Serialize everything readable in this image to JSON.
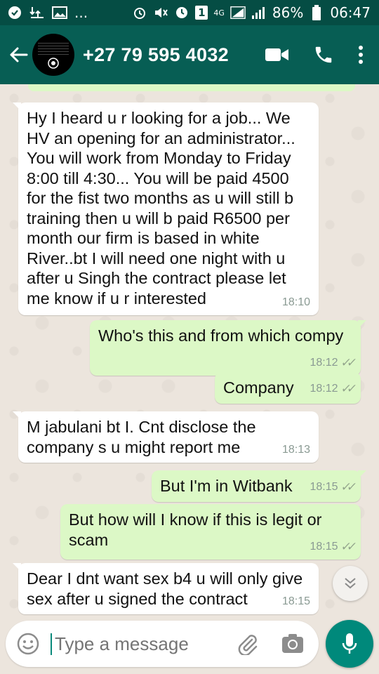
{
  "status_bar": {
    "left_ellipsis": "...",
    "network": "4G",
    "sim_badge": "1",
    "battery": "86%",
    "time": "06:47"
  },
  "header": {
    "contact": "+27 79 595 4032"
  },
  "messages": [
    {
      "dir": "in",
      "text": "Hy I heard u r looking for a job... We HV an opening for an administrator... You will work from Monday to Friday 8:00 till 4:30... You will be paid 4500 for the fist two months as u will still b training then u will b paid R6500 per month our firm is based in white River..bt I will need one night with u after u Singh the contract please let me know if u r interested",
      "time": "18:10"
    },
    {
      "dir": "out",
      "text": "Who's this and from which compy",
      "time": "18:12"
    },
    {
      "dir": "out",
      "text": "Company",
      "time": "18:12"
    },
    {
      "dir": "in",
      "text": "M jabulani bt I. Cnt disclose the company s u might report me",
      "time": "18:13"
    },
    {
      "dir": "out",
      "text": "But I'm in Witbank",
      "time": "18:15"
    },
    {
      "dir": "out",
      "text": "But how will I know if this is legit or scam",
      "time": "18:15"
    },
    {
      "dir": "in",
      "text": "Dear I dnt want sex b4 u will only give sex after u signed the contract",
      "time": "18:15"
    }
  ],
  "composer": {
    "placeholder": "Type a message"
  },
  "colors": {
    "header": "#075e54",
    "status_bar": "#054d44",
    "outgoing_bubble": "#dcf8c6",
    "incoming_bubble": "#ffffff",
    "fab": "#00897b"
  }
}
